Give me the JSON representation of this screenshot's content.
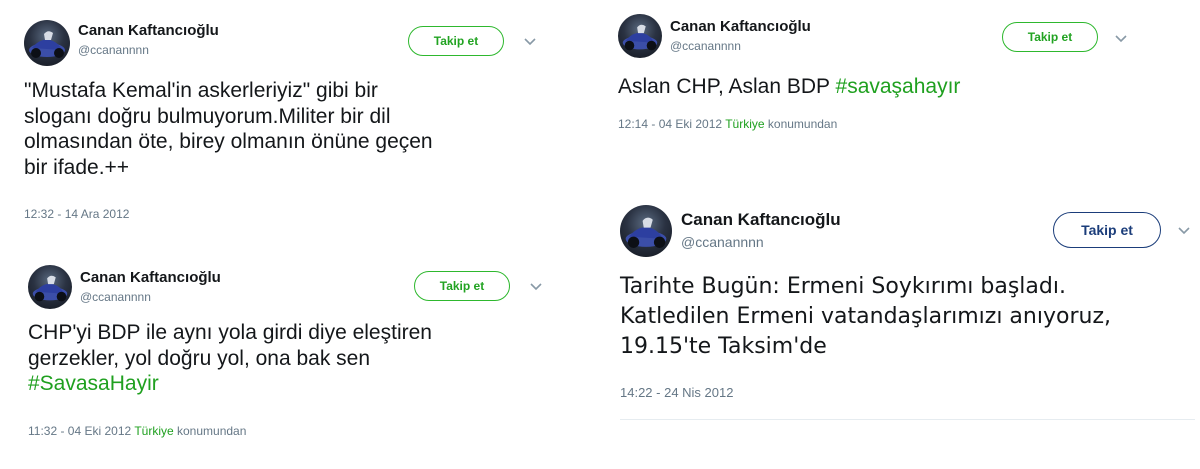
{
  "tweets": [
    {
      "name": "Canan Kaftancıoğlu",
      "handle": "@ccanannnn",
      "follow_label": "Takip et",
      "text_lines": [
        "\"Mustafa Kemal'in askerleriyiz\" gibi bir",
        "sloganı doğru bulmuyorum.Militer bir dil",
        "olmasından öte, birey olmanın önüne geçen",
        "bir ifade.++"
      ],
      "timestamp": "12:32 - 14 Ara 2012"
    },
    {
      "name": "Canan Kaftancıoğlu",
      "handle": "@ccanannnn",
      "follow_label": "Takip et",
      "text_lines": [
        "CHP'yi BDP ile aynı yola girdi diye eleştiren",
        "gerzekler, yol doğru yol, ona bak sen"
      ],
      "hashtag": "#SavasaHayir",
      "timestamp": "11:32 - 04 Eki 2012",
      "location": "Türkiye",
      "location_suffix": "konumundan"
    },
    {
      "name": "Canan Kaftancıoğlu",
      "handle": "@ccanannnn",
      "follow_label": "Takip et",
      "text_prefix": "Aslan CHP, Aslan BDP ",
      "hashtag": "#savaşahayır",
      "timestamp": "12:14 - 04 Eki 2012",
      "location": "Türkiye",
      "location_suffix": "konumundan"
    },
    {
      "name": "Canan Kaftancıoğlu",
      "handle": "@ccanannnn",
      "follow_label": "Takip et",
      "text_lines": [
        "Tarihte Bugün: Ermeni Soykırımı başladı.",
        "Katledilen Ermeni vatandaşlarımızı anıyoruz,",
        "19.15'te Taksim'de"
      ],
      "timestamp": "14:22 - 24 Nis 2012"
    }
  ],
  "icons": {
    "chevron": "chevron-down-icon",
    "avatar": "avatar"
  },
  "colors": {
    "hashtag": "#1fa01f",
    "follow_green": "#2eb82e",
    "follow_blue": "#1b3d7a",
    "meta_gray": "#657786"
  }
}
